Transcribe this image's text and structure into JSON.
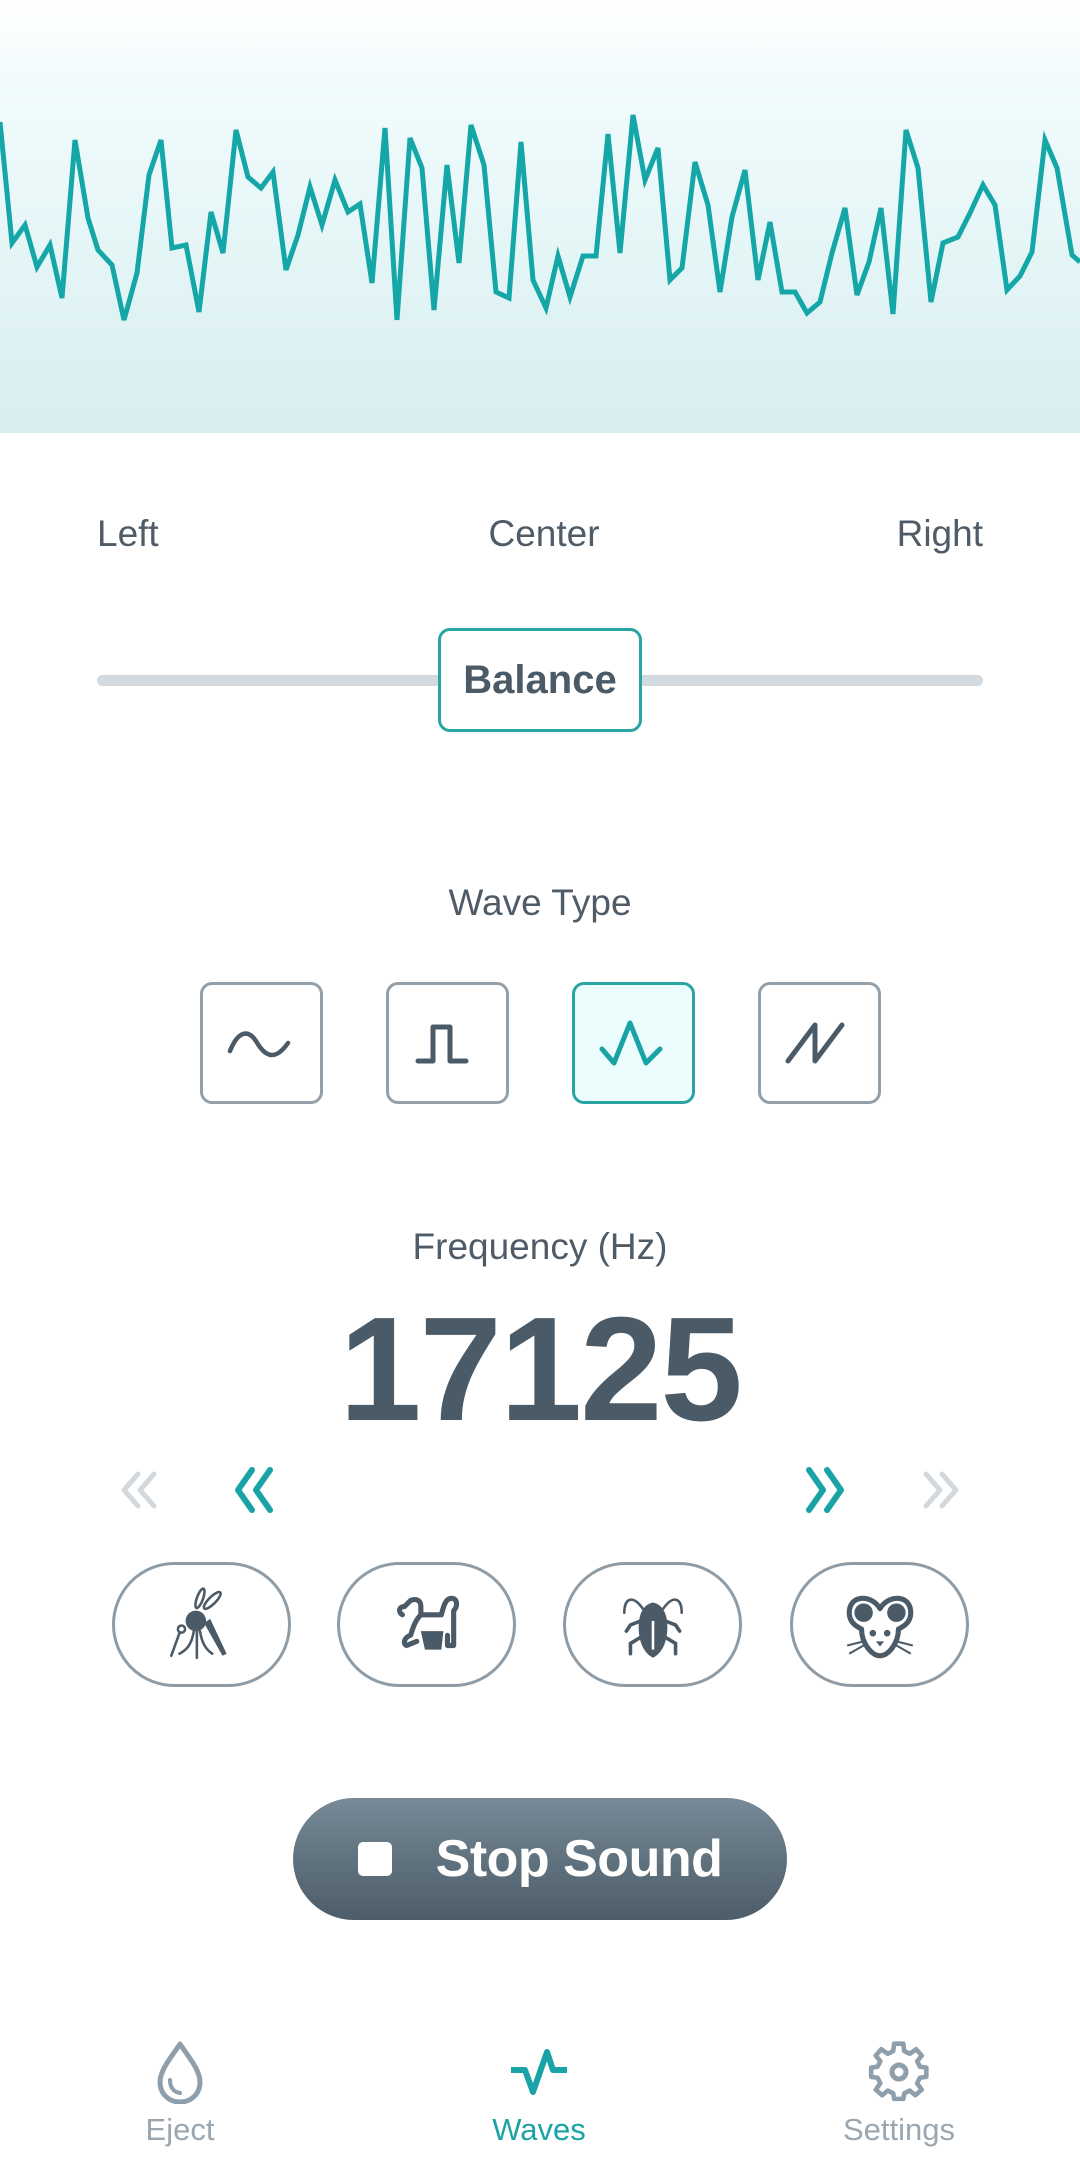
{
  "waveform": {
    "color": "#15a6a8",
    "description": "live oscilloscope trace of generated sound",
    "points": [
      [
        0,
        122
      ],
      [
        12,
        243
      ],
      [
        25,
        225
      ],
      [
        37,
        267
      ],
      [
        50,
        245
      ],
      [
        62,
        298
      ],
      [
        75,
        140
      ],
      [
        88,
        218
      ],
      [
        98,
        250
      ],
      [
        112,
        265
      ],
      [
        124,
        320
      ],
      [
        137,
        273
      ],
      [
        149,
        175
      ],
      [
        161,
        140
      ],
      [
        172,
        248
      ],
      [
        186,
        245
      ],
      [
        199,
        312
      ],
      [
        211,
        212
      ],
      [
        223,
        253
      ],
      [
        236,
        130
      ],
      [
        248,
        177
      ],
      [
        261,
        188
      ],
      [
        273,
        172
      ],
      [
        286,
        270
      ],
      [
        298,
        235
      ],
      [
        310,
        187
      ],
      [
        322,
        225
      ],
      [
        335,
        180
      ],
      [
        348,
        212
      ],
      [
        360,
        204
      ],
      [
        372,
        283
      ],
      [
        385,
        128
      ],
      [
        397,
        320
      ],
      [
        410,
        138
      ],
      [
        422,
        168
      ],
      [
        434,
        310
      ],
      [
        447,
        165
      ],
      [
        459,
        263
      ],
      [
        471,
        125
      ],
      [
        484,
        165
      ],
      [
        496,
        292
      ],
      [
        509,
        298
      ],
      [
        521,
        142
      ],
      [
        533,
        280
      ],
      [
        546,
        308
      ],
      [
        558,
        256
      ],
      [
        570,
        297
      ],
      [
        583,
        256
      ],
      [
        596,
        256
      ],
      [
        608,
        134
      ],
      [
        620,
        253
      ],
      [
        633,
        115
      ],
      [
        645,
        180
      ],
      [
        658,
        148
      ],
      [
        670,
        280
      ],
      [
        682,
        268
      ],
      [
        695,
        162
      ],
      [
        708,
        205
      ],
      [
        720,
        292
      ],
      [
        732,
        217
      ],
      [
        745,
        170
      ],
      [
        758,
        280
      ],
      [
        770,
        222
      ],
      [
        782,
        292
      ],
      [
        795,
        292
      ],
      [
        807,
        313
      ],
      [
        820,
        302
      ],
      [
        832,
        253
      ],
      [
        845,
        208
      ],
      [
        857,
        295
      ],
      [
        869,
        262
      ],
      [
        881,
        208
      ],
      [
        893,
        314
      ],
      [
        906,
        130
      ],
      [
        918,
        168
      ],
      [
        931,
        302
      ],
      [
        943,
        243
      ],
      [
        958,
        237
      ],
      [
        970,
        213
      ],
      [
        983,
        185
      ],
      [
        995,
        205
      ],
      [
        1007,
        290
      ],
      [
        1020,
        276
      ],
      [
        1032,
        252
      ],
      [
        1045,
        140
      ],
      [
        1057,
        168
      ],
      [
        1072,
        255
      ],
      [
        1080,
        262
      ]
    ]
  },
  "balance": {
    "left_label": "Left",
    "center_label": "Center",
    "right_label": "Right",
    "thumb_label": "Balance",
    "value": 0.5
  },
  "wave_type": {
    "title": "Wave Type",
    "options": [
      {
        "name": "sine",
        "icon": "sine-wave-icon",
        "selected": false
      },
      {
        "name": "square",
        "icon": "square-wave-icon",
        "selected": false
      },
      {
        "name": "triangle",
        "icon": "triangle-wave-icon",
        "selected": true
      },
      {
        "name": "sawtooth",
        "icon": "sawtooth-wave-icon",
        "selected": false
      }
    ]
  },
  "frequency": {
    "title": "Frequency (Hz)",
    "value": "17125",
    "controls": [
      {
        "name": "decrease-large",
        "icon": "double-chevron-left-icon",
        "enabled": false
      },
      {
        "name": "decrease",
        "icon": "double-chevron-left-icon",
        "enabled": true
      },
      {
        "name": "increase",
        "icon": "double-chevron-right-icon",
        "enabled": true
      },
      {
        "name": "increase-large",
        "icon": "double-chevron-right-icon",
        "enabled": false
      }
    ]
  },
  "presets": [
    {
      "name": "mosquito",
      "icon": "mosquito-icon"
    },
    {
      "name": "dog",
      "icon": "dog-icon"
    },
    {
      "name": "cockroach",
      "icon": "cockroach-icon"
    },
    {
      "name": "mouse",
      "icon": "mouse-icon"
    }
  ],
  "stop_button": {
    "label": "Stop Sound",
    "icon": "stop-icon"
  },
  "tab_bar": {
    "tabs": [
      {
        "label": "Eject",
        "icon": "water-drop-icon",
        "active": false
      },
      {
        "label": "Waves",
        "icon": "pulse-wave-icon",
        "active": true
      },
      {
        "label": "Settings",
        "icon": "gear-icon",
        "active": false
      }
    ]
  },
  "colors": {
    "accent": "#1aa3a6",
    "text": "#4b5a67",
    "muted": "#9aa6b0",
    "border": "#939fa9",
    "track": "#d2d9df",
    "disabled_chevron": "#d3d8dc"
  }
}
